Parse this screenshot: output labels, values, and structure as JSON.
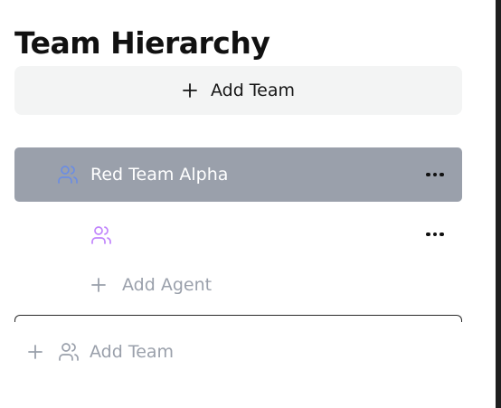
{
  "header": {
    "title": "Team Hierarchy"
  },
  "top_action": {
    "label": "Add Team",
    "icon": "plus-icon"
  },
  "team": {
    "name": "Red Team Alpha",
    "icon": "users-icon",
    "menu_icon": "more-horizontal-icon",
    "agents": [
      {
        "name": "",
        "icon": "users-icon",
        "menu_icon": "more-horizontal-icon"
      }
    ],
    "add_agent_label": "Add Agent"
  },
  "bottom_action": {
    "label": "Add Team",
    "icon": "plus-icon",
    "secondary_icon": "users-icon"
  },
  "colors": {
    "selected_row_bg": "#9aa0ab",
    "top_button_bg": "#f3f4f4",
    "muted_text": "#9aa0ab",
    "agent_icon": "#c084fc",
    "team_icon_selected": "#6b8de3"
  }
}
